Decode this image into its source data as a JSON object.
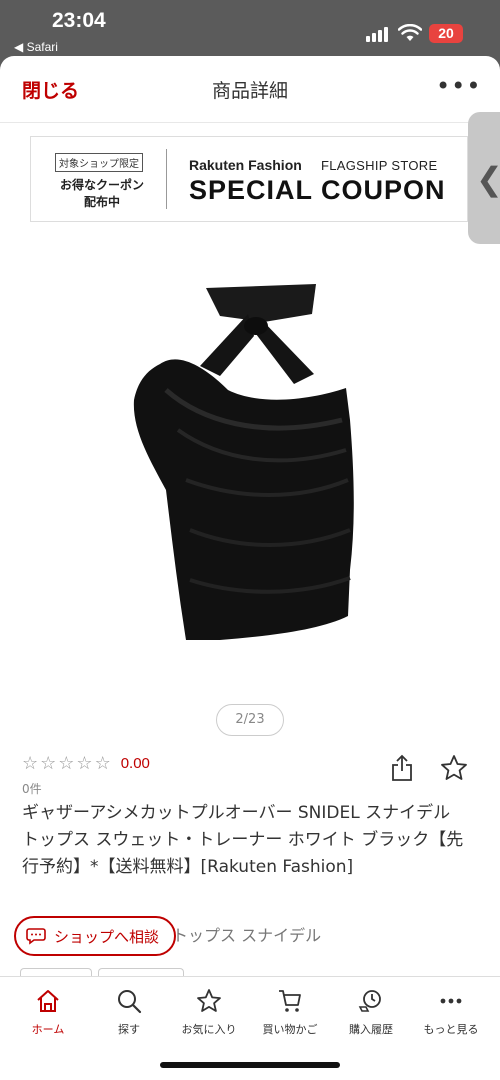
{
  "status_bar": {
    "time": "23:04",
    "back_app": "◀ Safari",
    "battery": "20"
  },
  "header": {
    "close_label": "閉じる",
    "title": "商品詳細",
    "more_label": "•••"
  },
  "side_tab": {
    "chevron": "❮"
  },
  "banner": {
    "badge": "対象ショップ限定",
    "left_line1": "お得なクーポン",
    "left_line2": "配布中",
    "brand": "Rakuten Fashion",
    "flagship": "FLAGSHIP STORE",
    "coupon": "SPECIAL COUPON"
  },
  "gallery": {
    "counter": "2/23"
  },
  "rating": {
    "stars": [
      "☆",
      "☆",
      "☆",
      "☆",
      "☆"
    ],
    "value": "0.00",
    "count": "0件"
  },
  "product": {
    "name": "ギャザーアシメカットプルオーバー SNIDEL スナイデル トップス スウェット・トレーナー ホワイト ブラック【先行予約】*【送料無料】[Rakuten Fashion]",
    "brand_line": "トップス スナイデル"
  },
  "chat_button": {
    "label": "ショップへ相談"
  },
  "tabs": [
    {
      "label": "ホーム",
      "icon": "home-icon",
      "active": true
    },
    {
      "label": "探す",
      "icon": "search-icon",
      "active": false
    },
    {
      "label": "お気に入り",
      "icon": "star-icon",
      "active": false
    },
    {
      "label": "買い物かご",
      "icon": "cart-icon",
      "active": false
    },
    {
      "label": "購入履歴",
      "icon": "history-icon",
      "active": false
    },
    {
      "label": "もっと見る",
      "icon": "more-icon",
      "active": false
    }
  ],
  "colors": {
    "accent": "#bf0000",
    "battery": "#e8433f"
  }
}
